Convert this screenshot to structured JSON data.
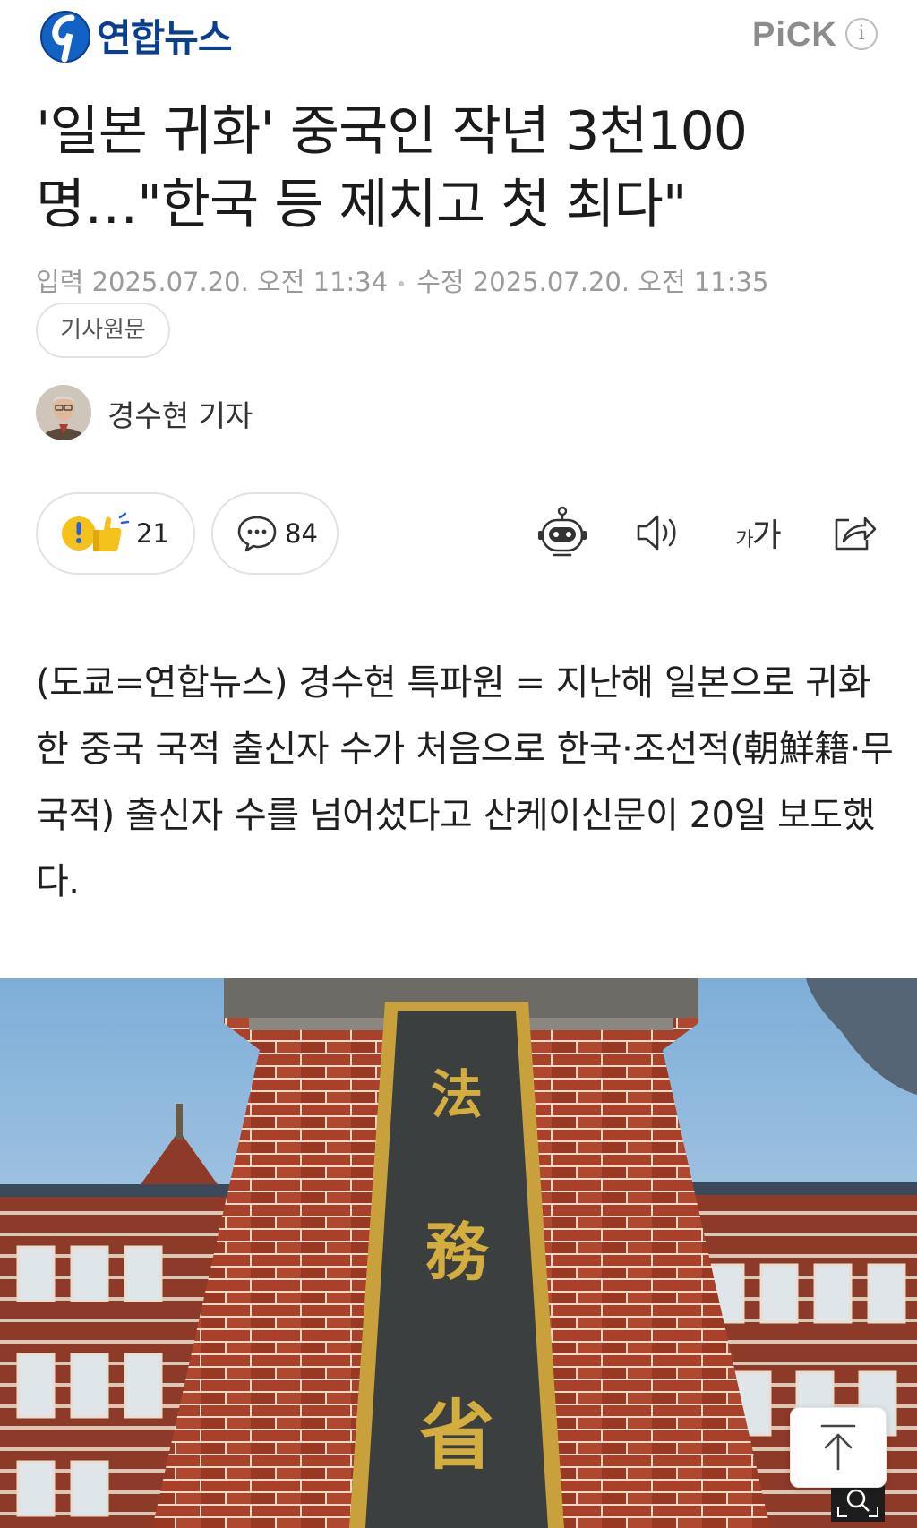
{
  "brand": {
    "name": "연합뉴스",
    "pick_label": "PiCK",
    "info_label": "i"
  },
  "article": {
    "headline": "'일본 귀화' 중국인 작년 3천100명…\"한국 등 제치고 첫 최다\"",
    "input_time": "입력 2025.07.20. 오전 11:34",
    "edit_time": "수정 2025.07.20. 오전 11:35",
    "original_label": "기사원문",
    "reporter": "경수현 기자",
    "body": "(도쿄=연합뉴스) 경수현 특파원 = 지난해 일본으로 귀화한 중국 국적 출신자 수가 처음으로 한국·조선적(朝鮮籍·무국적) 출신자 수를 넘어섰다고 산케이신문이 20일 보도했다."
  },
  "actions": {
    "reaction_count": "21",
    "comment_count": "84",
    "font_size_label": "가가"
  },
  "photo": {
    "signboard_chars": [
      "法",
      "務",
      "省"
    ]
  },
  "icons": {
    "logo": "yonhap-logo-icon",
    "info": "info-icon",
    "reaction": "reaction-emoji-icon",
    "comment": "speech-bubble-icon",
    "robot": "ai-summary-robot-icon",
    "speaker": "speaker-icon",
    "share": "share-icon",
    "top": "arrow-up-icon",
    "zoom": "zoom-icon"
  },
  "colors": {
    "brand_blue": "#0a3f8f",
    "accent_yellow": "#f5c21b",
    "brick": "#9c3b22"
  }
}
